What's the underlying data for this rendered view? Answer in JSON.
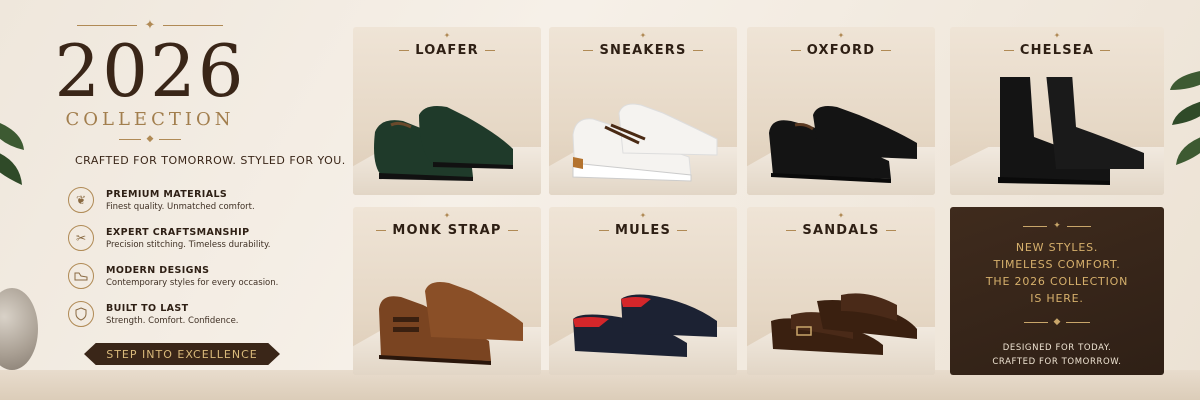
{
  "hero": {
    "year": "2026",
    "collection": "COLLECTION",
    "tagline": "CRAFTED FOR TOMORROW. STYLED FOR YOU."
  },
  "features": [
    {
      "icon": "leather-icon",
      "title": "PREMIUM MATERIALS",
      "desc": "Finest quality. Unmatched comfort."
    },
    {
      "icon": "craft-tools-icon",
      "title": "EXPERT CRAFTSMANSHIP",
      "desc": "Precision stitching. Timeless durability."
    },
    {
      "icon": "shoe-icon",
      "title": "MODERN DESIGNS",
      "desc": "Contemporary styles for every occasion."
    },
    {
      "icon": "shield-icon",
      "title": "BUILT TO LAST",
      "desc": "Strength. Comfort. Confidence."
    }
  ],
  "cta": {
    "label": "STEP INTO EXCELLENCE"
  },
  "cards": [
    {
      "title": "LOAFER",
      "color": "#1f3a2a"
    },
    {
      "title": "SNEAKERS",
      "color": "#f5f3f0"
    },
    {
      "title": "OXFORD",
      "color": "#141414"
    },
    {
      "title": "CHELSEA",
      "color": "#141414"
    },
    {
      "title": "MONK STRAP",
      "color": "#7a4421"
    },
    {
      "title": "MULES",
      "color": "#1c2233"
    },
    {
      "title": "SANDALS",
      "color": "#4a2a18"
    }
  ],
  "promo": {
    "lines": [
      "NEW STYLES.",
      "TIMELESS COMFORT.",
      "THE 2026 COLLECTION",
      "IS HERE."
    ],
    "sub": [
      "DESIGNED FOR TODAY.",
      "CRAFTED FOR TOMORROW."
    ]
  },
  "colors": {
    "accent_gold": "#b08a55",
    "dark_brown": "#3a2618"
  }
}
